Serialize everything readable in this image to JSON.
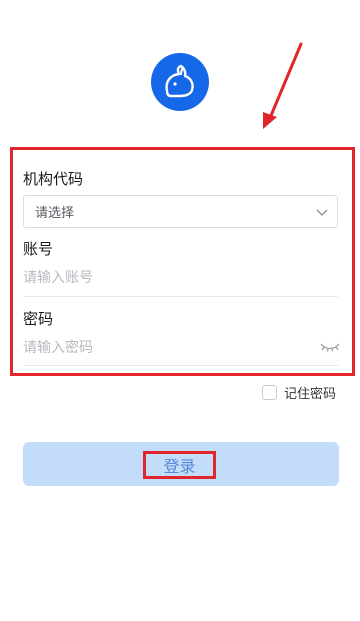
{
  "logo": {
    "icon": "rabbit-icon",
    "color": "#1568e8"
  },
  "form": {
    "org_label": "机构代码",
    "org_select_value": "请选择",
    "account_label": "账号",
    "account_placeholder": "请输入账号",
    "password_label": "密码",
    "password_placeholder": "请输入密码"
  },
  "remember": {
    "label": "记住密码",
    "checked": false
  },
  "login": {
    "label": "登录",
    "color": "#c2dcf9"
  },
  "annotation": {
    "color": "#e0252b"
  }
}
